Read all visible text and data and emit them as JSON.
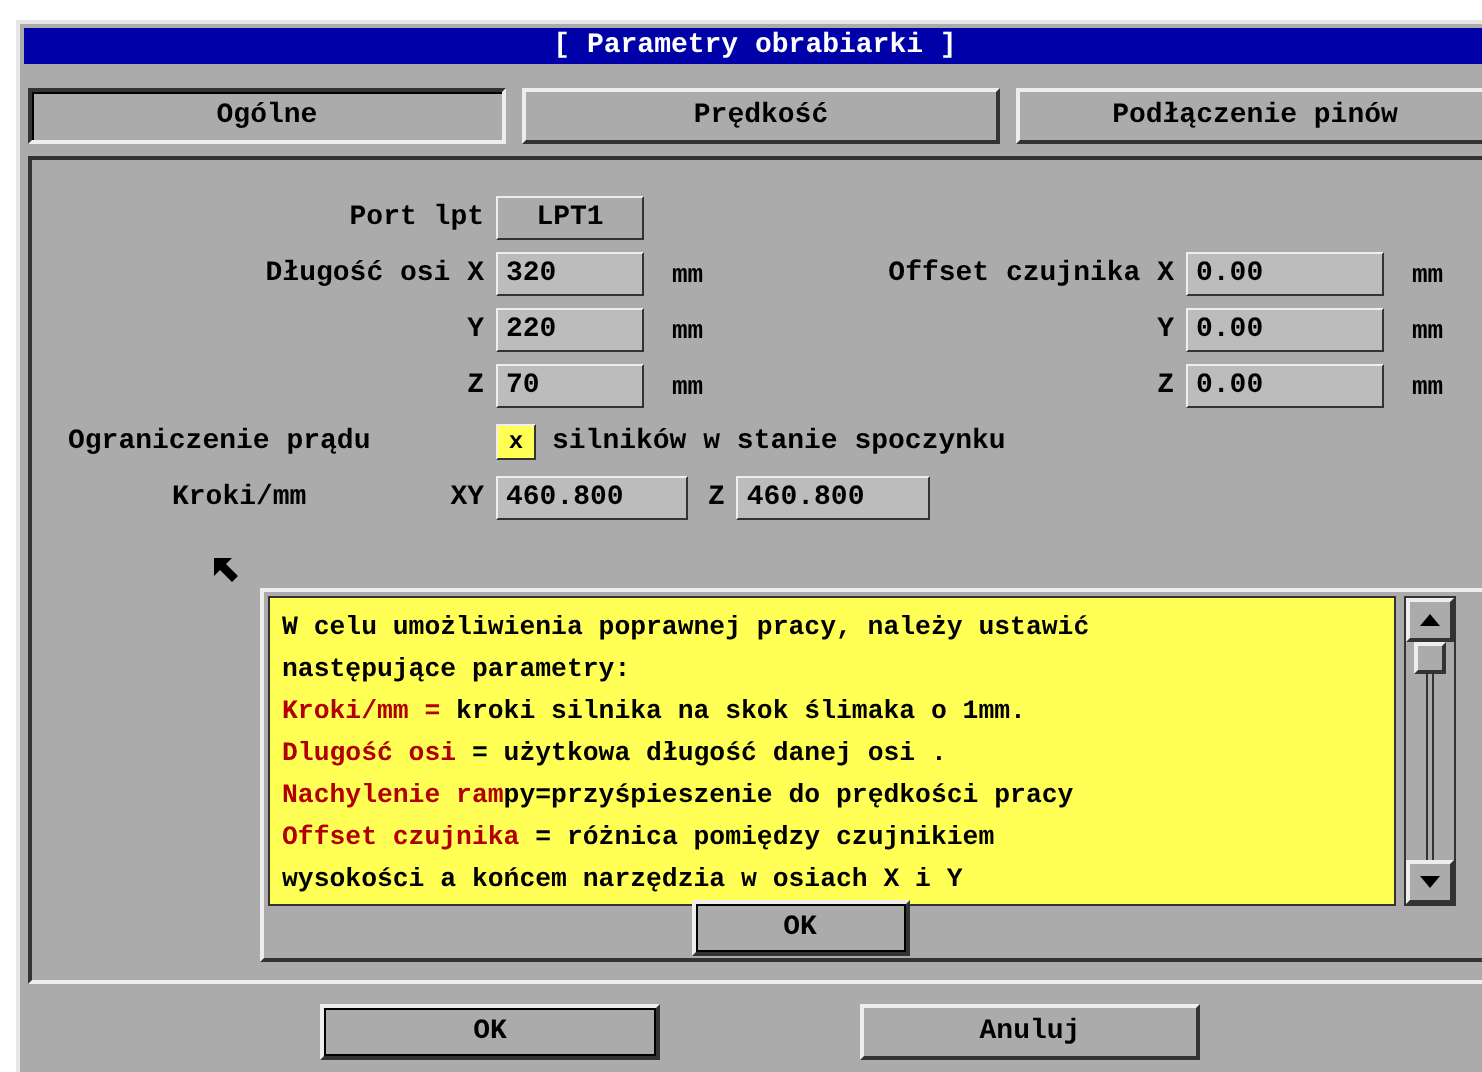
{
  "window": {
    "title": "[ Parametry obrabiarki ]"
  },
  "tabs": [
    {
      "label": "Ogólne",
      "selected": true
    },
    {
      "label": "Prędkość",
      "selected": false
    },
    {
      "label": "Podłączenie pinów",
      "selected": false
    }
  ],
  "port": {
    "label": "Port lpt",
    "value": "LPT1"
  },
  "axis_rows": [
    {
      "label": "Długość osi X",
      "value": "320",
      "unit": "mm",
      "offset_label": "Offset czujnika X",
      "offset_value": "0.00",
      "offset_unit": "mm"
    },
    {
      "label": "Y",
      "value": "220",
      "unit": "mm",
      "offset_label": "Y",
      "offset_value": "0.00",
      "offset_unit": "mm"
    },
    {
      "label": "Z",
      "value": "70",
      "unit": "mm",
      "offset_label": "Z",
      "offset_value": "0.00",
      "offset_unit": "mm"
    }
  ],
  "current_limit": {
    "label": "Ograniczenie prądu",
    "mark": "x",
    "checked": true,
    "suffix": "silników w stanie spoczynku"
  },
  "steps": {
    "label": "Kroki/mm",
    "xy_label": "XY",
    "xy_value": "460.800",
    "z_label": "Z",
    "z_value": "460.800"
  },
  "help": {
    "lines": [
      [
        {
          "text": "W celu umożliwienia poprawnej pracy, należy ustawić",
          "highlight": false
        }
      ],
      [
        {
          "text": "następujące parametry:",
          "highlight": false
        }
      ],
      [
        {
          "text": "Kroki/mm =",
          "highlight": true
        },
        {
          "text": " kroki silnika na skok ślimaka o 1mm.",
          "highlight": false
        }
      ],
      [
        {
          "text": "Dlugość osi",
          "highlight": true
        },
        {
          "text": " = użytkowa długość danej osi .",
          "highlight": false
        }
      ],
      [
        {
          "text": "Nachylenie ram",
          "highlight": true
        },
        {
          "text": "py=przyśpieszenie do prędkości pracy",
          "highlight": false
        }
      ],
      [
        {
          "text": "Offset czujnika",
          "highlight": true
        },
        {
          "text": " = różnica pomiędzy czujnikiem",
          "highlight": false
        }
      ],
      [
        {
          "text": "wysokości a końcem narzędzia w osiach X i Y",
          "highlight": false
        }
      ]
    ],
    "button": "OK"
  },
  "buttons": [
    {
      "label": "OK",
      "default": true
    },
    {
      "label": "Anuluj",
      "default": false
    }
  ]
}
